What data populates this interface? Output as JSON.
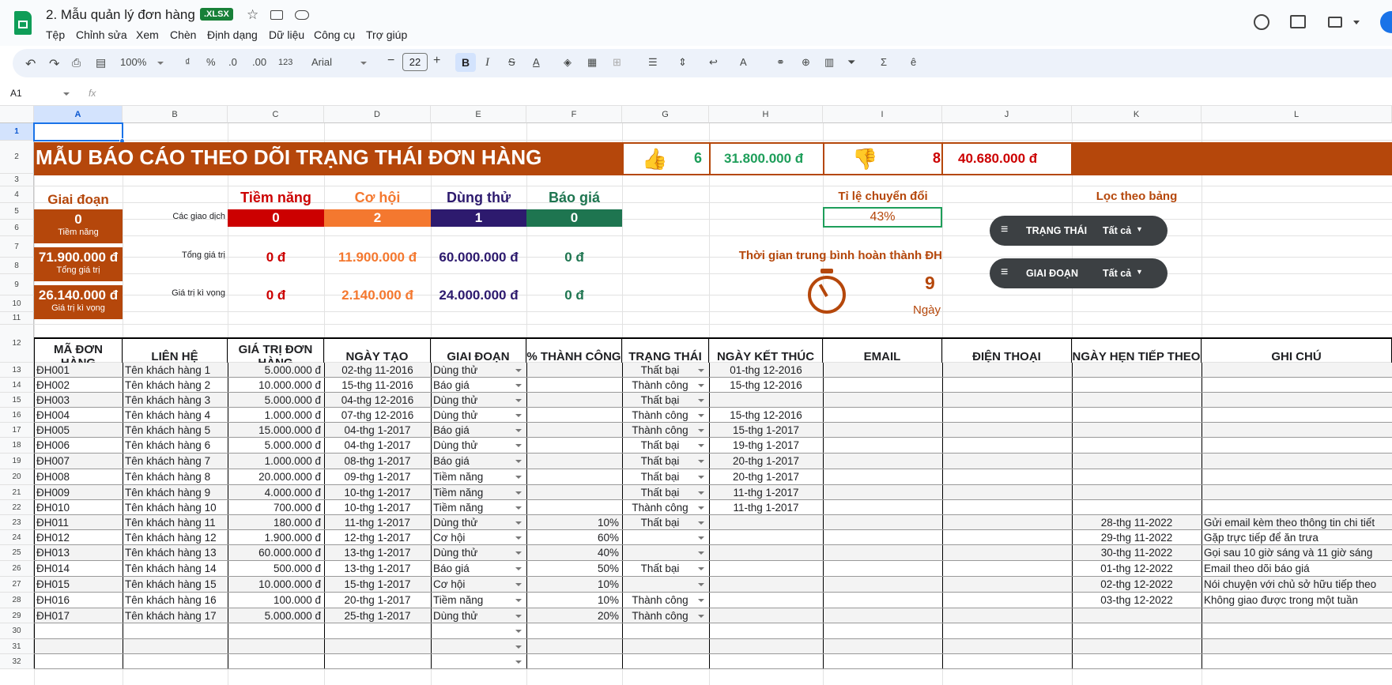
{
  "doc": {
    "title": "2. Mẫu quản lý đơn hàng",
    "badge": ".XLSX"
  },
  "menu": [
    "Tệp",
    "Chỉnh sửa",
    "Xem",
    "Chèn",
    "Định dạng",
    "Dữ liệu",
    "Công cụ",
    "Trợ giúp"
  ],
  "toolbar": {
    "zoom": "100%",
    "font": "Arial",
    "font_size": "22",
    "fmt_currency": "₫",
    "fmt_percent": "%",
    "fmt_dec_less": ".0",
    "fmt_dec_more": ".00",
    "fmt_123": "123",
    "bold": "B",
    "italic": "I",
    "strike": "S",
    "textcolor": "A"
  },
  "cellref": "A1",
  "fx": "fx",
  "columns": [
    "A",
    "B",
    "C",
    "D",
    "E",
    "F",
    "G",
    "H",
    "I",
    "J",
    "K",
    "L"
  ],
  "rows": [
    "1",
    "2",
    "3",
    "4",
    "5",
    "6",
    "7",
    "8",
    "9",
    "10",
    "11",
    "12",
    "13",
    "14",
    "15",
    "16",
    "17",
    "18",
    "19",
    "20",
    "21",
    "22",
    "23",
    "24",
    "25",
    "26",
    "27",
    "28",
    "29",
    "30",
    "31",
    "32"
  ],
  "banner": {
    "title": "MẪU BÁO CÁO THEO DÕI TRẠNG THÁI ĐƠN HÀNG",
    "win_count": "6",
    "win_value": "31.800.000 đ",
    "loss_count": "8",
    "loss_value": "40.680.000 đ"
  },
  "stage_box": {
    "label": "Giai đoạn",
    "count": "0",
    "count_sub": "Tiềm năng",
    "total": "71.900.000 đ",
    "total_sub": "Tổng giá trị",
    "expected": "26.140.000 đ",
    "expected_sub": "Giá trị kì vọng"
  },
  "stages": {
    "headers": [
      "Tiềm năng",
      "Cơ hội",
      "Dùng thử",
      "Báo giá"
    ],
    "deals_label": "Các giao dịch",
    "deals": [
      "0",
      "2",
      "1",
      "0"
    ],
    "total_label": "Tổng giá trị",
    "totals": [
      "0 đ",
      "11.900.000 đ",
      "60.000.000 đ",
      "0 đ"
    ],
    "expected_label": "Giá trị kì vọng",
    "expected": [
      "0 đ",
      "2.140.000 đ",
      "24.000.000 đ",
      "0 đ"
    ],
    "colors": [
      "#cc0000",
      "#f4782f",
      "#2d1a6e",
      "#1e7550"
    ]
  },
  "conversion": {
    "label": "Tỉ lệ chuyển đổi",
    "value": "43%"
  },
  "avg_time": {
    "label": "Thời gian trung bình hoàn thành ĐH",
    "value": "9",
    "unit": "Ngày"
  },
  "filters": {
    "label": "Lọc theo bảng",
    "f1_name": "TRẠNG THÁI",
    "f1_val": "Tất cả",
    "f2_name": "GIAI ĐOẠN",
    "f2_val": "Tất cả"
  },
  "table": {
    "headers": [
      "MÃ ĐƠN HÀNG",
      "LIÊN HỆ",
      "GIÁ TRỊ ĐƠN HÀNG",
      "NGÀY TẠO",
      "GIAI ĐOẠN",
      "% THÀNH CÔNG",
      "TRẠNG THÁI",
      "NGÀY KẾT THÚC",
      "EMAIL",
      "ĐIỆN THOẠI",
      "NGÀY HẸN TIẾP THEO",
      "GHI CHÚ"
    ],
    "rows": [
      [
        "ĐH001",
        "Tên khách hàng 1",
        "5.000.000 đ",
        "02-thg 11-2016",
        "Dùng thử",
        "",
        "Thất bại",
        "01-thg 12-2016",
        "",
        "",
        "",
        ""
      ],
      [
        "ĐH002",
        "Tên khách hàng 2",
        "10.000.000 đ",
        "15-thg 11-2016",
        "Báo giá",
        "",
        "Thành công",
        "15-thg 12-2016",
        "",
        "",
        "",
        ""
      ],
      [
        "ĐH003",
        "Tên khách hàng 3",
        "5.000.000 đ",
        "04-thg 12-2016",
        "Dùng thử",
        "",
        "Thất bại",
        "",
        "",
        "",
        "",
        ""
      ],
      [
        "ĐH004",
        "Tên khách hàng 4",
        "1.000.000 đ",
        "07-thg 12-2016",
        "Dùng thử",
        "",
        "Thành công",
        "15-thg 12-2016",
        "",
        "",
        "",
        ""
      ],
      [
        "ĐH005",
        "Tên khách hàng 5",
        "15.000.000 đ",
        "04-thg 1-2017",
        "Báo giá",
        "",
        "Thành công",
        "15-thg 1-2017",
        "",
        "",
        "",
        ""
      ],
      [
        "ĐH006",
        "Tên khách hàng 6",
        "5.000.000 đ",
        "04-thg 1-2017",
        "Dùng thử",
        "",
        "Thất bại",
        "19-thg 1-2017",
        "",
        "",
        "",
        ""
      ],
      [
        "ĐH007",
        "Tên khách hàng 7",
        "1.000.000 đ",
        "08-thg 1-2017",
        "Báo giá",
        "",
        "Thất bại",
        "20-thg 1-2017",
        "",
        "",
        "",
        ""
      ],
      [
        "ĐH008",
        "Tên khách hàng 8",
        "20.000.000 đ",
        "09-thg 1-2017",
        "Tiềm năng",
        "",
        "Thất bại",
        "20-thg 1-2017",
        "",
        "",
        "",
        ""
      ],
      [
        "ĐH009",
        "Tên khách hàng 9",
        "4.000.000 đ",
        "10-thg 1-2017",
        "Tiềm năng",
        "",
        "Thất bại",
        "11-thg 1-2017",
        "",
        "",
        "",
        ""
      ],
      [
        "ĐH010",
        "Tên khách hàng 10",
        "700.000 đ",
        "10-thg 1-2017",
        "Tiềm năng",
        "",
        "Thành công",
        "11-thg 1-2017",
        "",
        "",
        "",
        ""
      ],
      [
        "ĐH011",
        "Tên khách hàng 11",
        "180.000 đ",
        "11-thg 1-2017",
        "Dùng thử",
        "10%",
        "Thất bại",
        "",
        "",
        "",
        "28-thg 11-2022",
        "Gửi email kèm theo thông tin chi tiết"
      ],
      [
        "ĐH012",
        "Tên khách hàng 12",
        "1.900.000 đ",
        "12-thg 1-2017",
        "Cơ hội",
        "60%",
        "",
        "",
        "",
        "",
        "29-thg 11-2022",
        "Gặp trực tiếp để ăn trưa"
      ],
      [
        "ĐH013",
        "Tên khách hàng 13",
        "60.000.000 đ",
        "13-thg 1-2017",
        "Dùng thử",
        "40%",
        "",
        "",
        "",
        "",
        "30-thg 11-2022",
        "Gọi sau 10 giờ sáng và 11 giờ sáng"
      ],
      [
        "ĐH014",
        "Tên khách hàng 14",
        "500.000 đ",
        "13-thg 1-2017",
        "Báo giá",
        "50%",
        "Thất bại",
        "",
        "",
        "",
        "01-thg 12-2022",
        "Email theo dõi báo giá"
      ],
      [
        "ĐH015",
        "Tên khách hàng 15",
        "10.000.000 đ",
        "15-thg 1-2017",
        "Cơ hội",
        "10%",
        "",
        "",
        "",
        "",
        "02-thg 12-2022",
        "Nói chuyện với chủ sở hữu tiếp theo"
      ],
      [
        "ĐH016",
        "Tên khách hàng 16",
        "100.000 đ",
        "20-thg 1-2017",
        "Tiềm năng",
        "10%",
        "Thành công",
        "",
        "",
        "",
        "03-thg 12-2022",
        "Không giao được trong một tuần"
      ],
      [
        "ĐH017",
        "Tên khách hàng 17",
        "5.000.000 đ",
        "25-thg 1-2017",
        "Dùng thử",
        "20%",
        "Thành công",
        "",
        "",
        "",
        "",
        ""
      ],
      [
        "",
        "",
        "",
        "",
        "",
        "",
        "",
        "",
        "",
        "",
        "",
        ""
      ],
      [
        "",
        "",
        "",
        "",
        "",
        "",
        "",
        "",
        "",
        "",
        "",
        ""
      ],
      [
        "",
        "",
        "",
        "",
        "",
        "",
        "",
        "",
        "",
        "",
        "",
        ""
      ]
    ]
  }
}
